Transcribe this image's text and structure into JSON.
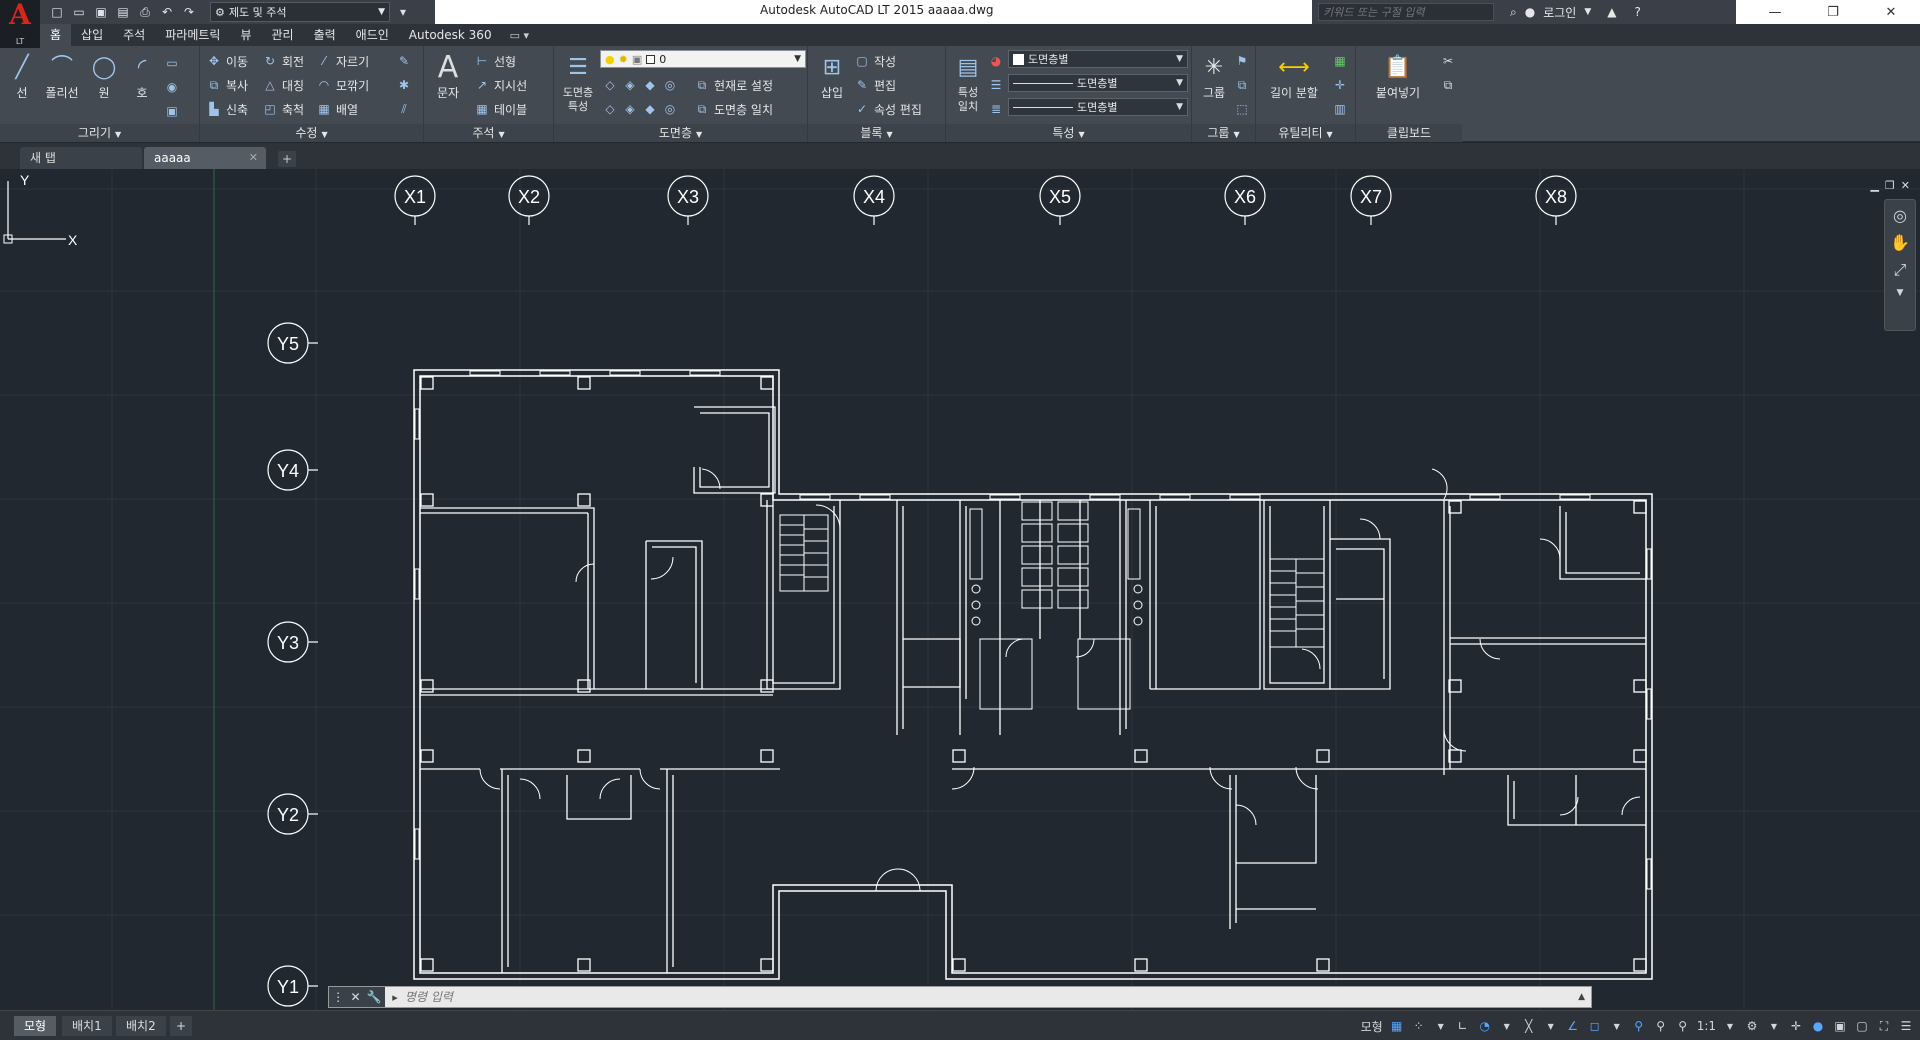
{
  "app": {
    "logo_letter": "A",
    "logo_sub": "LT",
    "title": "Autodesk AutoCAD LT 2015     aaaaa.dwg",
    "workspace": "제도 및 주석",
    "search_placeholder": "키워드 또는 구절 입력",
    "login": "로그인"
  },
  "ribbon_tabs": [
    "홈",
    "삽입",
    "주석",
    "파라메트릭",
    "뷰",
    "관리",
    "출력",
    "애드인",
    "Autodesk 360"
  ],
  "ribbon": {
    "draw": {
      "title": "그리기",
      "line": "선",
      "polyline": "폴리선",
      "circle": "원",
      "arc": "호"
    },
    "modify": {
      "title": "수정",
      "move": "이동",
      "rotate": "회전",
      "trim": "자르기",
      "copy": "복사",
      "mirror": "대칭",
      "fillet": "모깎기",
      "stretch": "신축",
      "scale": "축척",
      "array": "배열"
    },
    "annotation": {
      "title": "주석",
      "text": "문자",
      "linear": "선형",
      "leader": "지시선",
      "table": "테이블"
    },
    "layers": {
      "title": "도면층",
      "properties": "도면층\n특성",
      "current_layer": "0",
      "make_current": "현재로 설정",
      "match_layer": "도면층 일치"
    },
    "block": {
      "title": "블록",
      "insert": "삽입",
      "create": "작성",
      "edit": "편집",
      "edit_attr": "속성 편집"
    },
    "properties": {
      "title": "특성",
      "match": "특성\n일치",
      "color": "도면층별",
      "linetype": "도면층별",
      "lineweight": "도면층별"
    },
    "groups": {
      "title": "그룹",
      "group": "그룹"
    },
    "utilities": {
      "title": "유틸리티",
      "measure": "길이 분할"
    },
    "clipboard": {
      "title": "클립보드",
      "paste": "붙여넣기"
    }
  },
  "file_tabs": [
    {
      "label": "새 탭",
      "active": false
    },
    {
      "label": "aaaaa",
      "active": true
    }
  ],
  "drawing": {
    "grid_x": [
      "X1",
      "X2",
      "X3",
      "X4",
      "X5",
      "X6",
      "X7",
      "X8"
    ],
    "grid_y": [
      "Y5",
      "Y4",
      "Y3",
      "Y2",
      "Y1"
    ],
    "ucs_x": "X",
    "ucs_y": "Y"
  },
  "command": {
    "placeholder": "명령 입력"
  },
  "layout_tabs": [
    "모형",
    "배치1",
    "배치2"
  ],
  "status": {
    "model": "모형",
    "scale": "1:1"
  },
  "colors": {
    "background": "#212830",
    "ribbon": "#434a52",
    "accent_red": "#d9251c",
    "linework": "#ffffff"
  }
}
